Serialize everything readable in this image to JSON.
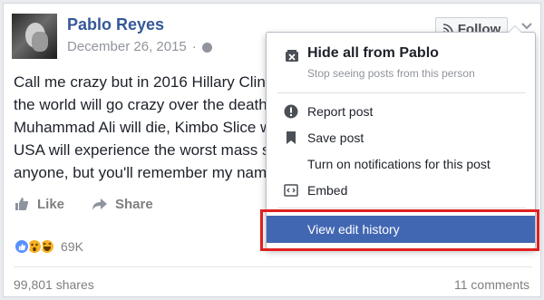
{
  "post": {
    "author": "Pablo Reyes",
    "date": "December 26, 2015",
    "date_sep": "·",
    "follow_label": "Follow",
    "lines": [
      "Call me crazy but in 2016 Hillary Clint",
      "the world will go crazy over the death",
      "Muhammad Ali will die, Kimbo Slice w",
      "USA will experience the worst mass s",
      "anyone, but you'll remember my nam"
    ],
    "like_label": "Like",
    "share_label": "Share",
    "reaction_count": "69K",
    "shares": "99,801 shares",
    "comments": "11 comments"
  },
  "menu": {
    "hide_title": "Hide all from Pablo",
    "hide_sub": "Stop seeing posts from this person",
    "items": [
      {
        "label": "Report post",
        "icon": "report-icon"
      },
      {
        "label": "Save post",
        "icon": "bookmark-icon"
      },
      {
        "label": "Turn on notifications for this post",
        "icon": ""
      },
      {
        "label": "Embed",
        "icon": "embed-icon"
      },
      {
        "label": "View edit history",
        "icon": ""
      }
    ]
  },
  "colors": {
    "link_blue": "#365899",
    "highlight": "#4267b2",
    "annotation_red": "#e02020"
  }
}
